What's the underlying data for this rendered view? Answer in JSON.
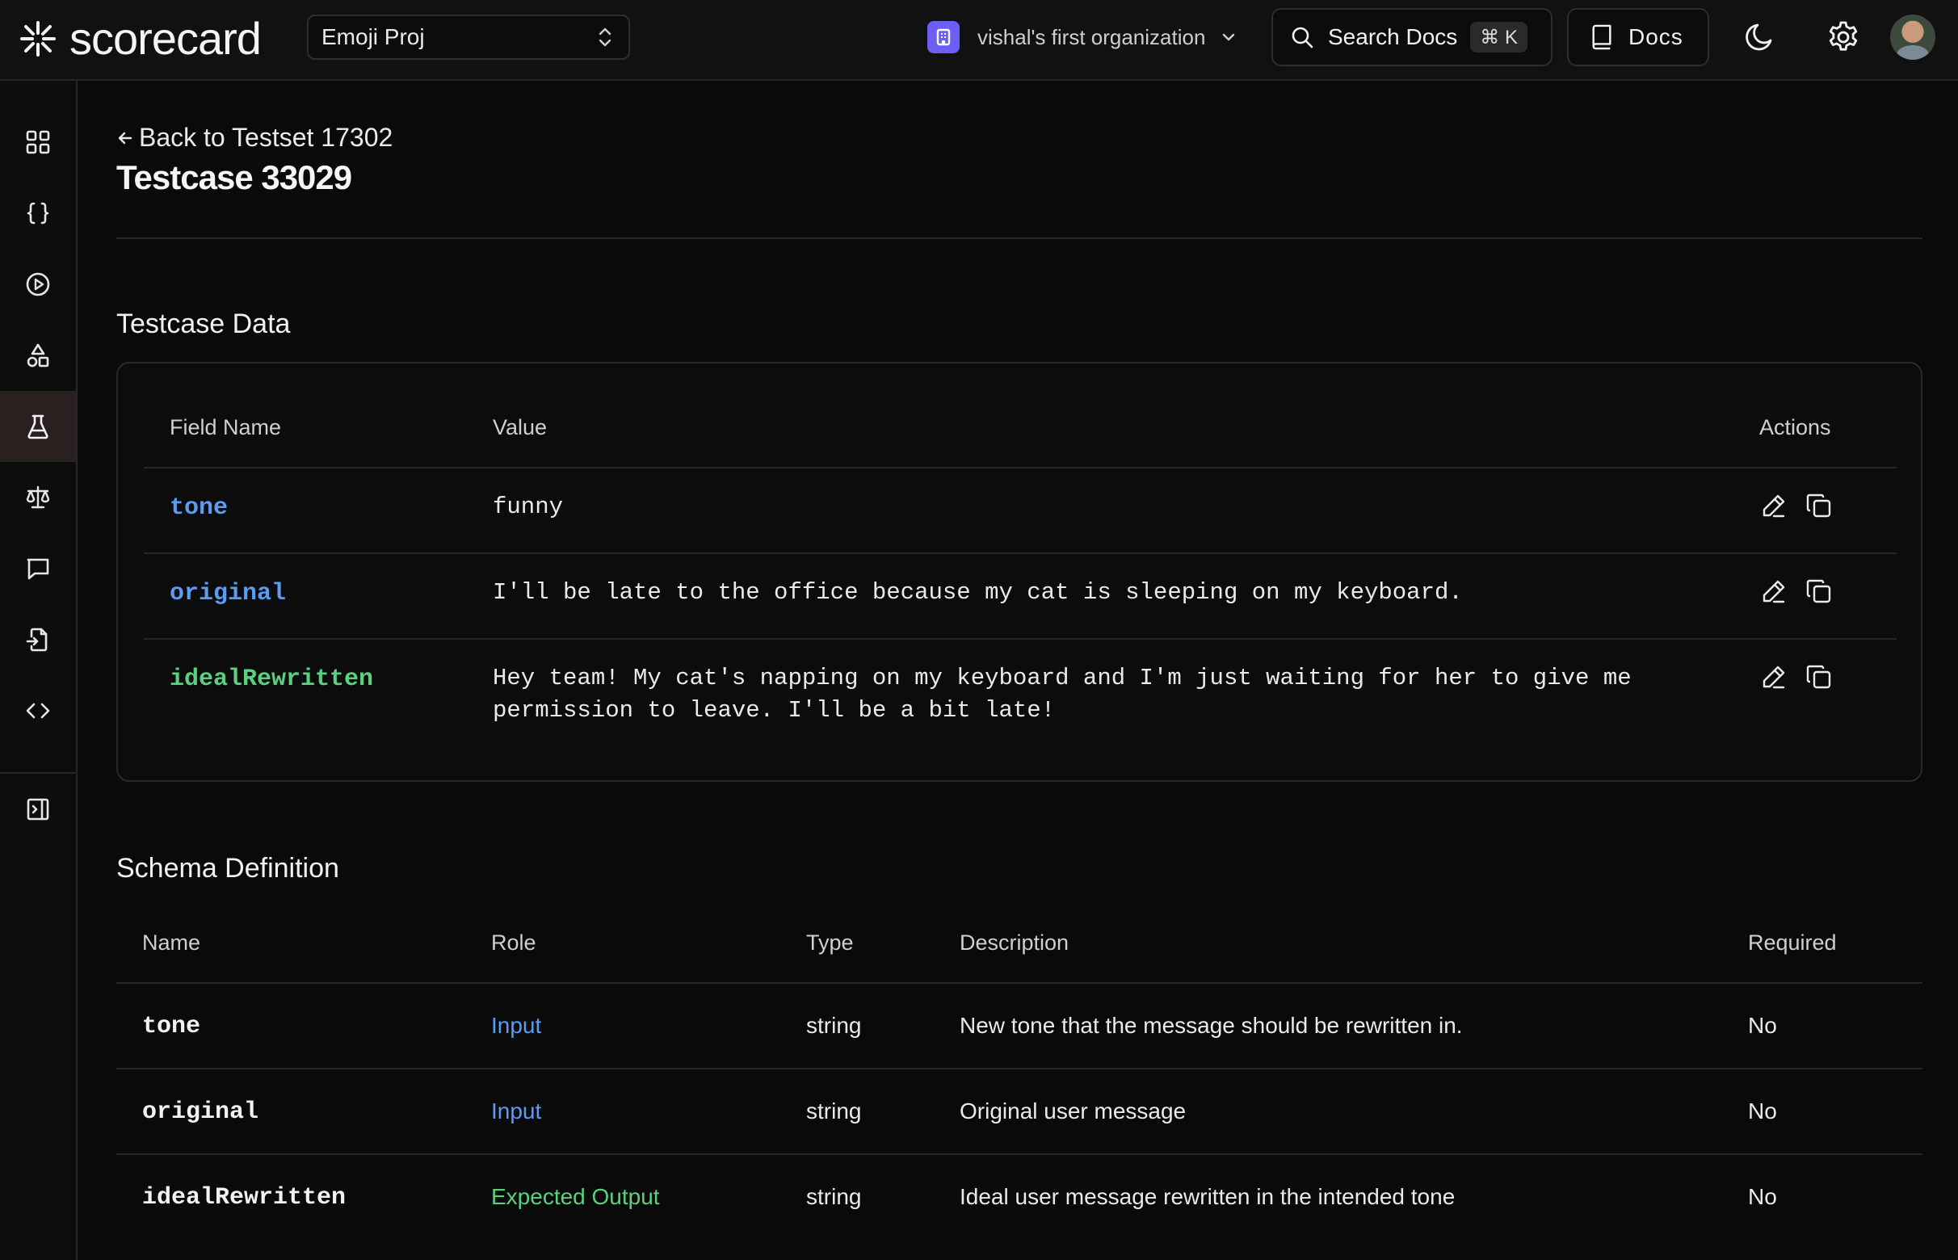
{
  "brand": {
    "name": "scorecard"
  },
  "project_select": {
    "label": "Emoji Proj"
  },
  "organization": {
    "name": "vishal's first organization"
  },
  "search": {
    "label": "Search Docs",
    "shortcut": "⌘ K"
  },
  "docs": {
    "label": "Docs"
  },
  "sidebar": {
    "items": [
      {
        "icon": "grid-icon"
      },
      {
        "icon": "braces-icon"
      },
      {
        "icon": "play-circle-icon"
      },
      {
        "icon": "shapes-icon"
      },
      {
        "icon": "flask-icon",
        "active": true
      },
      {
        "icon": "scale-icon"
      },
      {
        "icon": "message-icon"
      },
      {
        "icon": "file-export-icon"
      },
      {
        "icon": "code-icon"
      },
      {
        "icon": "panel-toggle-icon"
      }
    ]
  },
  "header": {
    "back_label": "Back to Testset 17302",
    "title": "Testcase 33029"
  },
  "testcase_data": {
    "title": "Testcase Data",
    "columns": {
      "field": "Field Name",
      "value": "Value",
      "actions": "Actions"
    },
    "rows": [
      {
        "field": "tone",
        "value": "funny"
      },
      {
        "field": "original",
        "value": "I'll be late to the office because my cat is sleeping on my keyboard."
      },
      {
        "field": "idealRewritten",
        "value": "Hey team! My cat's napping on my keyboard and I'm just waiting for her to give me\npermission to leave. I'll be a bit late!"
      }
    ]
  },
  "schema": {
    "title": "Schema Definition",
    "columns": {
      "name": "Name",
      "role": "Role",
      "type": "Type",
      "description": "Description",
      "required": "Required"
    },
    "rows": [
      {
        "name": "tone",
        "role": "Input",
        "type": "string",
        "description": "New tone that the message should be rewritten in.",
        "required": "No"
      },
      {
        "name": "original",
        "role": "Input",
        "type": "string",
        "description": "Original user message",
        "required": "No"
      },
      {
        "name": "idealRewritten",
        "role": "Expected Output",
        "type": "string",
        "description": "Ideal user message rewritten in the intended tone",
        "required": "No"
      }
    ]
  },
  "colors": {
    "input_role": "#5b9cf0",
    "expected_output_role": "#5bd080",
    "org_badge": "#6d5ff5"
  }
}
